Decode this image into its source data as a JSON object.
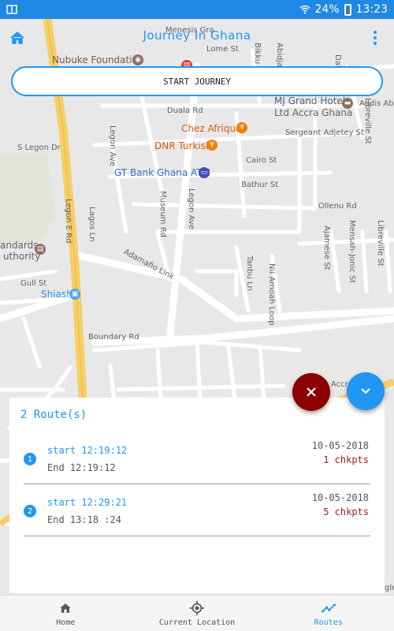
{
  "status_bar": {
    "battery": "24%",
    "time": "13:23"
  },
  "header": {
    "title": "Journey In Ghana",
    "home_icon": "home-icon",
    "menu_icon": "more-vert-icon"
  },
  "start_button": {
    "label": "START JOURNEY"
  },
  "map": {
    "labels": {
      "nubuke": "Nubuke Foundation",
      "mjgrand": "MJ Grand Hotel",
      "mjgrand2": "Ltd Accra Ghana",
      "chez": "Chez Afrique",
      "dnr": "DNR Turkish",
      "gtbank": "GT Bank Ghana ATM",
      "standards": "andards",
      "authority": "uthority",
      "shiashie": "Shiashie",
      "duala": "Duala Rd",
      "legon_ave": "Legon Ave",
      "slegon": "S Legon Dr",
      "sergeant": "Sergeant Adjetey St",
      "cairo": "Cairo St",
      "bathur": "Bathur St",
      "ollenu": "Ollenu Rd",
      "legon_e": "Legon E Rd",
      "lagos": "Lagos Ln",
      "museum": "Museum Rd",
      "adamafio": "Adamafio Link",
      "tanbu": "Tanbu Ln",
      "amoah": "Nii Amoah Loop",
      "ajamese": "Ajamese St",
      "mensah": "Mensah-Jonic St",
      "libreville": "Libreville St",
      "boundary": "Boundary Rd",
      "accra": "Accra",
      "gull": "Gull St",
      "lome": "Lome St",
      "menesis": "Menesis Gra",
      "bikku": "Bikku Ave",
      "abidjan": "Abidjan Ave",
      "dakar": "Dakar",
      "addis": "Addis Ababa Rd",
      "google": "gle"
    }
  },
  "routes_panel": {
    "title": "2 Route(s)",
    "routes": [
      {
        "num": "1",
        "start": "start 12:19:12",
        "end": "End 12:19:12",
        "date": "10-05-2018",
        "ckpts": "1 chkpts"
      },
      {
        "num": "2",
        "start": "start 12:29:21",
        "end": "End 13:18 :24",
        "date": "10-05-2018",
        "ckpts": "5 chkpts"
      }
    ]
  },
  "fabs": {
    "close_icon": "close-icon",
    "expand_icon": "chevron-down-icon"
  },
  "bottom_nav": [
    {
      "label": "Home",
      "icon": "home-icon"
    },
    {
      "label": "Current Location",
      "icon": "gps-icon"
    },
    {
      "label": "Routes",
      "icon": "timeline-icon",
      "active": true
    }
  ],
  "colors": {
    "accent": "#2196f3",
    "statusbar": "#1e88e5",
    "danger": "#8b0000"
  }
}
